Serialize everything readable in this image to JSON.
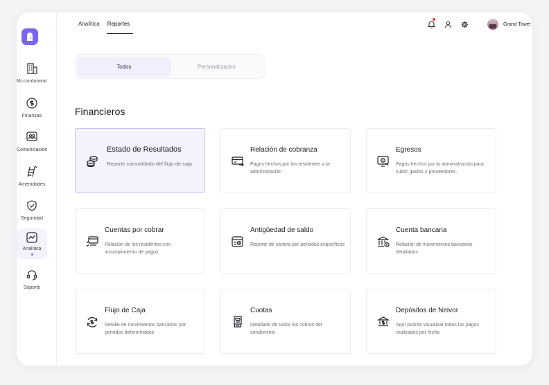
{
  "sidebar": {
    "items": [
      {
        "label": "Mi condominio",
        "icon": "building-icon"
      },
      {
        "label": "Finanzas",
        "icon": "dollar-circle-icon"
      },
      {
        "label": "Comunicaciones",
        "icon": "chat-users-icon"
      },
      {
        "label": "Amenidades",
        "icon": "pool-ladder-icon"
      },
      {
        "label": "Seguridad",
        "icon": "shield-check-icon"
      },
      {
        "label": "Analítica",
        "icon": "analytics-icon"
      },
      {
        "label": "Soporte",
        "icon": "headset-icon"
      }
    ]
  },
  "topnav": {
    "tabs": [
      {
        "label": "Analítica"
      },
      {
        "label": "Reportes"
      }
    ]
  },
  "user": {
    "name": "Grand Tower"
  },
  "segment": {
    "options": [
      {
        "label": "Todos"
      },
      {
        "label": "Personalizados"
      }
    ]
  },
  "section": {
    "title": "Financieros"
  },
  "cards": [
    {
      "title": "Estado de Resultados",
      "desc": "Reporte consolidado del flujo de caja.",
      "icon": "coins-stack-icon"
    },
    {
      "title": "Relación de cobranza",
      "desc": "Pagos hechos por los residentes a la administración",
      "icon": "card-transfer-icon"
    },
    {
      "title": "Egresos",
      "desc": "Pagos hechos por la administración para cubrir gastos y proveedores.",
      "icon": "screen-dollar-icon"
    },
    {
      "title": "Cuentas por cobrar",
      "desc": "Relación de los residentes con incumplimiento de pagos",
      "icon": "card-list-icon"
    },
    {
      "title": "Antigüedad de saldo",
      "desc": "Reporte de cartera por periodos específicos",
      "icon": "wallet-clock-icon"
    },
    {
      "title": "Cuenta bancaria",
      "desc": "Relación de movimientos bancarios detallados",
      "icon": "bank-icon"
    },
    {
      "title": "Flujo de Caja",
      "desc": "Detalle de movimientos bancarios por periodos determinados",
      "icon": "dollar-cycle-icon"
    },
    {
      "title": "Cuotas",
      "desc": "Detallado de todos los cobros del condominio",
      "icon": "receipt-icon"
    },
    {
      "title": "Depósitos de Neivor",
      "desc": "Aquí podrás visualizar todos los pagos realizados por fecha",
      "icon": "deposit-icon"
    }
  ],
  "colors": {
    "accent": "#7c66ef",
    "selected_bg": "#f4f2fd",
    "badge": "#e03a3a"
  }
}
